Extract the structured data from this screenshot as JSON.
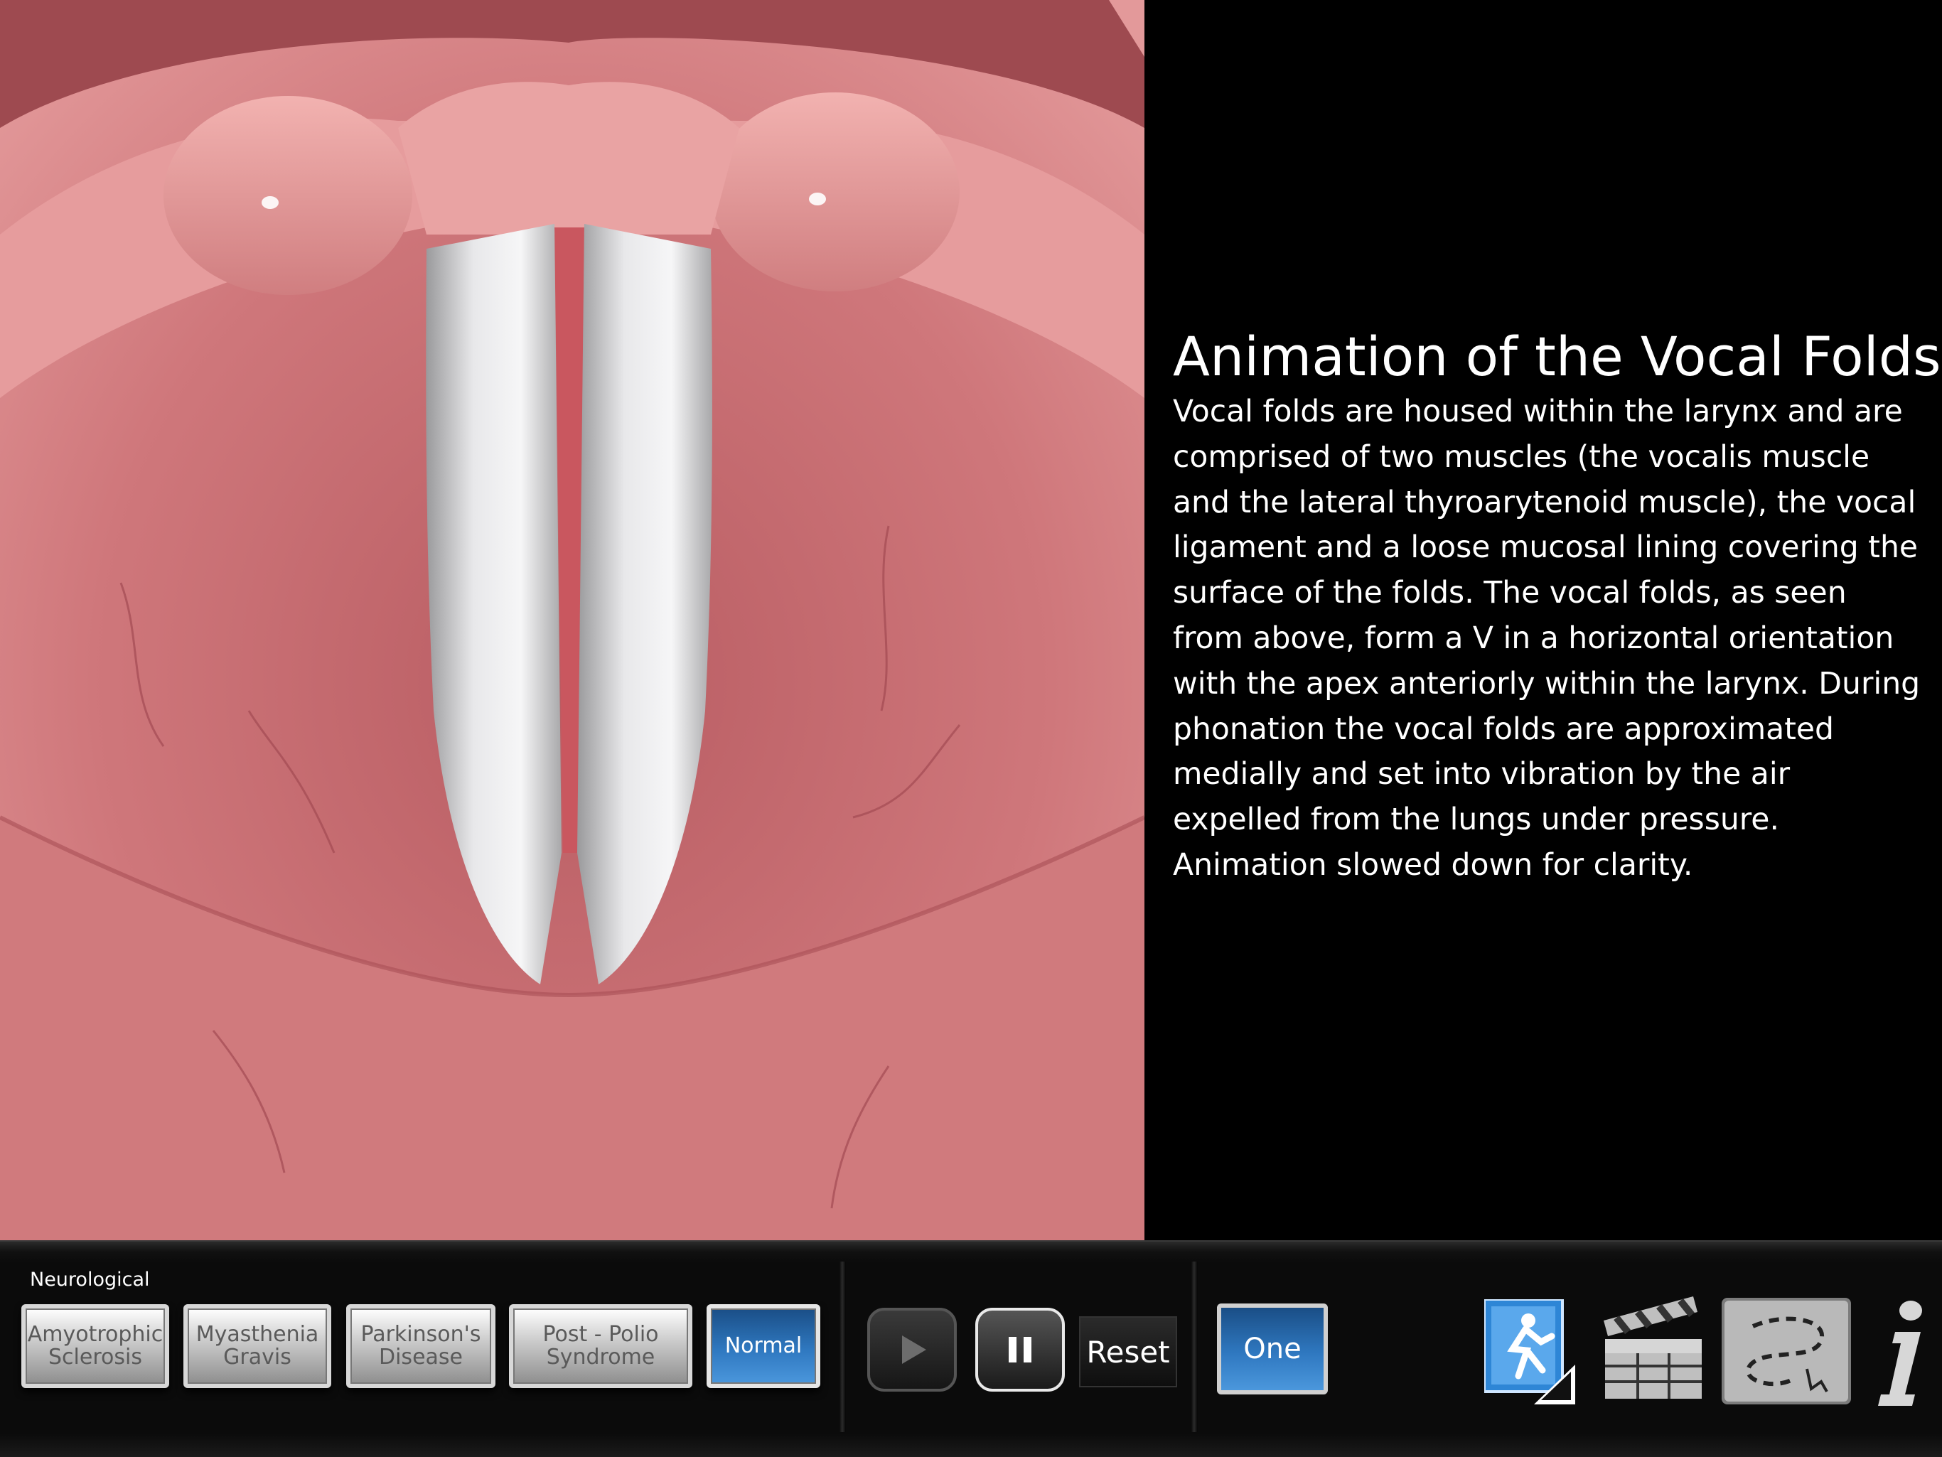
{
  "content": {
    "title": "Animation of the Vocal Folds",
    "description": "Vocal folds are housed within the larynx and are comprised of two muscles (the vocalis muscle and the lateral thyroarytenoid muscle), the vocal ligament and a loose mucosal lining covering the surface of the folds. The vocal folds, as seen from above, form a V in a horizontal orientation with the apex anteriorly within the larynx. During phonation the vocal folds are approximated medially and set into vibration by the air expelled from the lungs under pressure. Animation slowed down for clarity."
  },
  "toolbar": {
    "group_label": "Neurological",
    "conditions": [
      {
        "label": "Amyotrophic\nSclerosis",
        "active": false
      },
      {
        "label": "Myasthenia\nGravis",
        "active": false
      },
      {
        "label": "Parkinson's\nDisease",
        "active": false
      },
      {
        "label": "Post - Polio\nSyndrome",
        "active": false
      },
      {
        "label": "Normal",
        "active": true
      }
    ],
    "play_icon": "play-icon",
    "pause_icon": "pause-icon",
    "reset_label": "Reset",
    "one_label": "One",
    "icons": [
      "running-figure-icon",
      "clapperboard-icon",
      "gesture-path-icon",
      "info-icon"
    ]
  },
  "colors": {
    "tissue": "#c46b6f",
    "vocal_fold": "#e4e4e6",
    "active_button": "#2f78c0"
  }
}
